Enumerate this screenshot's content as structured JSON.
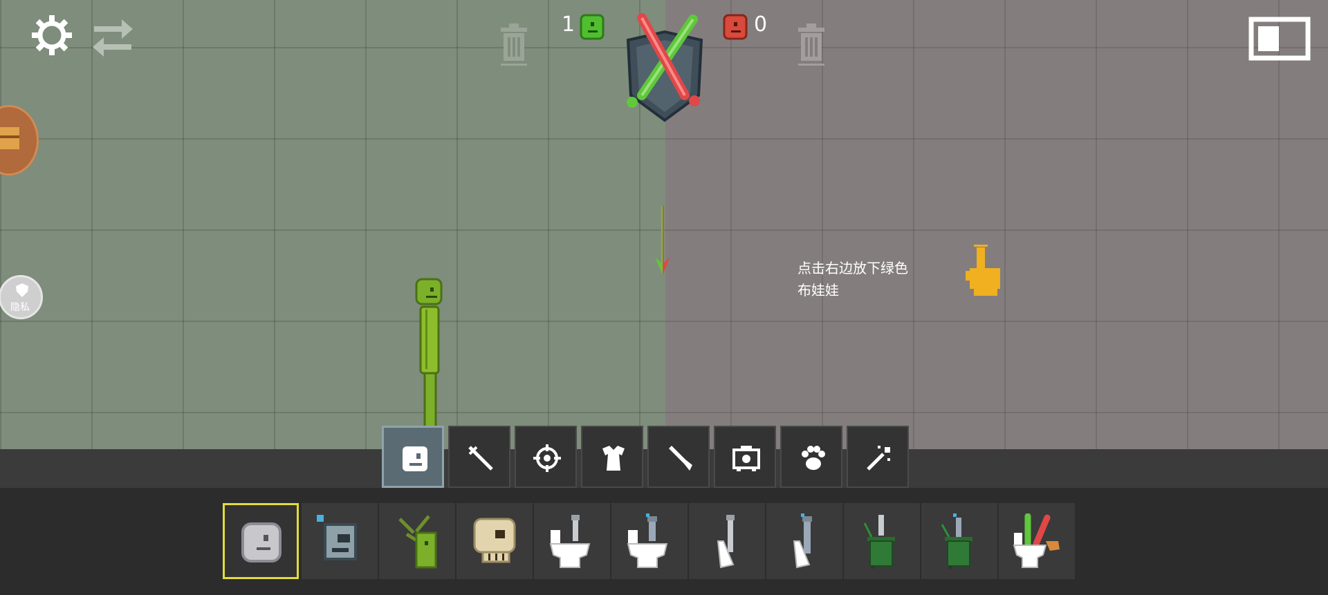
{
  "hud": {
    "score_green": "1",
    "score_red": "0",
    "hint_line1": "点击右边放下绿色",
    "hint_line2": "布娃娃",
    "privacy_label": "隐私"
  },
  "icons": {
    "settings": "gear-icon",
    "swap": "swap-arrows-icon",
    "trash_left": "trash-icon",
    "trash_right": "trash-icon",
    "versus_badge": "crossed-swords-icon",
    "layout_toggle": "window-layout-icon",
    "pointer_hand": "hand-pointer-icon",
    "drop_arrow": "down-arrow-icon"
  },
  "categories": [
    {
      "name": "category-characters",
      "icon": "character-head-icon",
      "selected": true
    },
    {
      "name": "category-melee",
      "icon": "sword-icon",
      "selected": false
    },
    {
      "name": "category-firearms",
      "icon": "crosshair-icon",
      "selected": false
    },
    {
      "name": "category-clothing",
      "icon": "shirt-icon",
      "selected": false
    },
    {
      "name": "category-explosives",
      "icon": "rocket-icon",
      "selected": false
    },
    {
      "name": "category-machines",
      "icon": "machine-icon",
      "selected": false
    },
    {
      "name": "category-animals",
      "icon": "paw-icon",
      "selected": false
    },
    {
      "name": "category-magic",
      "icon": "magic-wand-icon",
      "selected": false
    }
  ],
  "items": [
    {
      "name": "gray-ragdoll-head",
      "selected": true
    },
    {
      "name": "robot-head",
      "selected": false
    },
    {
      "name": "melon-plant-ragdoll",
      "selected": false
    },
    {
      "name": "skull-head",
      "selected": false
    },
    {
      "name": "skibidi-toilet-1",
      "selected": false
    },
    {
      "name": "skibidi-toilet-2",
      "selected": false
    },
    {
      "name": "skibidi-toilet-3",
      "selected": false
    },
    {
      "name": "skibidi-toilet-4",
      "selected": false
    },
    {
      "name": "trash-bin-toilet-1",
      "selected": false
    },
    {
      "name": "trash-bin-toilet-2",
      "selected": false
    },
    {
      "name": "melon-toilet",
      "selected": false
    }
  ],
  "colors": {
    "left_team": "#5fc83c",
    "right_team": "#e04848",
    "accent_hand": "#f0b020",
    "selected_item_border": "#e3dc3a"
  }
}
